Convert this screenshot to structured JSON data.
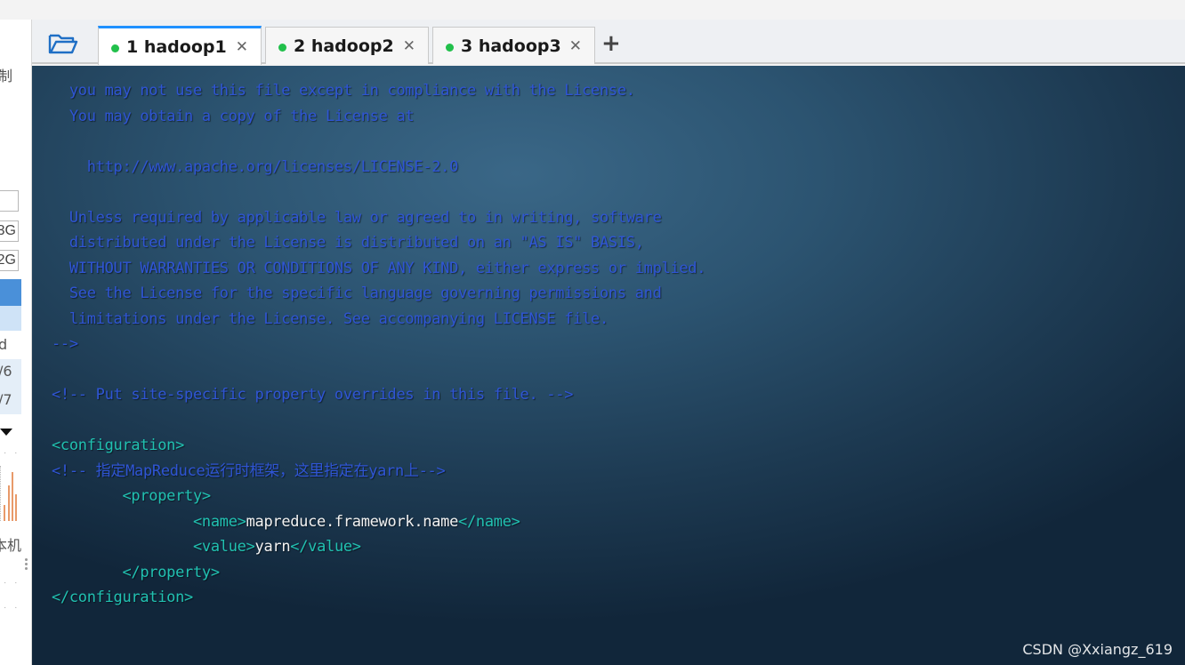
{
  "sidebar": {
    "fragments": [
      "制",
      "3G",
      "2G",
      "d",
      "/6",
      "/7",
      "本机"
    ]
  },
  "tabs": [
    {
      "label": "1 hadoop1",
      "active": true,
      "status_color": "#22c04b",
      "close": "✕"
    },
    {
      "label": "2 hadoop2",
      "active": false,
      "status_color": "#22c04b",
      "close": "✕"
    },
    {
      "label": "3 hadoop3",
      "active": false,
      "status_color": "#22c04b",
      "close": "✕"
    }
  ],
  "new_tab_label": "+",
  "terminal": {
    "lines": [
      {
        "t": [
          [
            "c-comment",
            "  you may not use this file except in compliance with the License."
          ]
        ]
      },
      {
        "t": [
          [
            "c-comment",
            "  You may obtain a copy of the License at"
          ]
        ]
      },
      {
        "t": []
      },
      {
        "t": [
          [
            "c-comment",
            "    http://www.apache.org/licenses/LICENSE-2.0"
          ]
        ]
      },
      {
        "t": []
      },
      {
        "t": [
          [
            "c-comment",
            "  Unless required by applicable law or agreed to in writing, software"
          ]
        ]
      },
      {
        "t": [
          [
            "c-comment",
            "  distributed under the License is distributed on an \"AS IS\" BASIS,"
          ]
        ]
      },
      {
        "t": [
          [
            "c-comment",
            "  WITHOUT WARRANTIES OR CONDITIONS OF ANY KIND, either express or implied."
          ]
        ]
      },
      {
        "t": [
          [
            "c-comment",
            "  See the License for the specific language governing permissions and"
          ]
        ]
      },
      {
        "t": [
          [
            "c-comment",
            "  limitations under the License. See accompanying LICENSE file."
          ]
        ]
      },
      {
        "t": [
          [
            "c-comment",
            "-->"
          ]
        ]
      },
      {
        "t": []
      },
      {
        "t": [
          [
            "c-comment",
            "<!-- Put site-specific property overrides in this file. -->"
          ]
        ]
      },
      {
        "t": []
      },
      {
        "t": [
          [
            "c-tag",
            "<configuration>"
          ]
        ]
      },
      {
        "t": [
          [
            "c-comment",
            "<!-- 指定MapReduce运行时框架，这里指定在yarn上-->"
          ]
        ]
      },
      {
        "t": [
          [
            "c-text",
            "        "
          ],
          [
            "c-tag",
            "<property>"
          ]
        ]
      },
      {
        "t": [
          [
            "c-text",
            "                "
          ],
          [
            "c-tag",
            "<name>"
          ],
          [
            "c-text",
            "mapreduce.framework.name"
          ],
          [
            "c-tag",
            "</name>"
          ]
        ]
      },
      {
        "t": [
          [
            "c-text",
            "                "
          ],
          [
            "c-tag",
            "<value>"
          ],
          [
            "c-text",
            "yarn"
          ],
          [
            "c-tag",
            "</value>"
          ]
        ]
      },
      {
        "t": [
          [
            "c-text",
            "        "
          ],
          [
            "c-tag",
            "</property>"
          ]
        ]
      },
      {
        "t": [
          [
            "c-tag",
            "</configuration>"
          ]
        ]
      }
    ]
  },
  "watermark": "CSDN @Xxiangz_619",
  "colors": {
    "comment": "#2f55d4",
    "tag": "#21c1b1",
    "text": "#f2f2f2",
    "active_tab_accent": "#1e90ff",
    "status_dot": "#22c04b"
  }
}
